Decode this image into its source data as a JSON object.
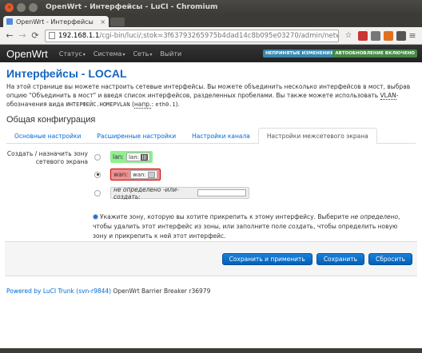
{
  "window": {
    "title": "OpenWrt - Интерфейсы - LuCI - Chromium"
  },
  "browser": {
    "tab_title": "OpenWrt - Интерфейсы",
    "url_host": "192.168.1.1",
    "url_path": "/cgi-bin/luci/;stok=3f63793265975b4dad14c8b095e03270/admin/network/network/local"
  },
  "navbar": {
    "brand": "OpenWrt",
    "items": [
      "Статус",
      "Система",
      "Сеть",
      "Выйти"
    ],
    "badge_changes": "Непринятые изменения: 8",
    "badge_refresh": "Автообновление включено"
  },
  "page": {
    "title": "Интерфейсы - LOCAL",
    "desc_part1": "На этой странице вы можете настроить сетевые интерфейсы. Вы можете объединить несколько интерфейсов в мост, выбрав опцию \"Объединить в мост\" и введя список интерфейсов, разделенных пробелами. Вы также можете использовать ",
    "desc_vlan": "VLAN",
    "desc_part2": "-обозначения вида ",
    "desc_code1": "ИНТЕРФЕЙС.НОМЕРVLAN",
    "desc_part3": " (",
    "desc_example": "напр.",
    "desc_part4": ": ",
    "desc_code2": "eth0.1",
    "desc_part5": ").",
    "section": "Общая конфигурация"
  },
  "tabs": [
    "Основные настройки",
    "Расширенные настройки",
    "Настройки канала",
    "Настройки межсетевого экрана"
  ],
  "firewall": {
    "label": "Создать / назначить зону сетевого экрана",
    "zones": [
      {
        "name": "lan:",
        "iface": "lan:"
      },
      {
        "name": "wan:",
        "iface": "wan:"
      }
    ],
    "none_label": "не определено -или- создать:",
    "hint_a": "Укажите зону, которую вы хотите прикрепить к этому интерфейсу. Выберите ",
    "hint_b": "не определено",
    "hint_c": ", чтобы удалить этот интерфейс из зоны, или заполните поле ",
    "hint_d": "создать",
    "hint_e": ", чтобы определить новую зону и прикрепить к ней этот интерфейс."
  },
  "buttons": {
    "save_apply": "Сохранить и применить",
    "save": "Сохранить",
    "reset": "Сбросить"
  },
  "footer": {
    "link": "Powered by LuCI Trunk (svn-r9844)",
    "text": " OpenWrt Barrier Breaker r36979"
  }
}
